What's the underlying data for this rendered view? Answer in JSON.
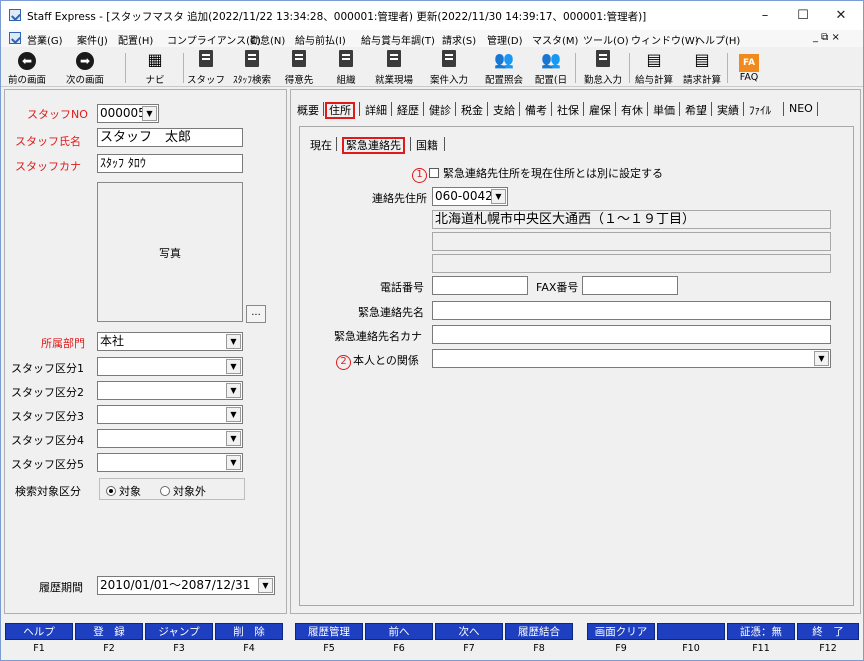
{
  "title_bar": {
    "text": "Staff Express - [スタッフマスタ 追加(2022/11/22 13:34:28、000001:管理者) 更新(2022/11/30 14:39:17、000001:管理者)]",
    "min": "–",
    "max": "☐",
    "close": "✕"
  },
  "menu": [
    "営業(G)",
    "案件(J)",
    "配置(H)",
    "コンプライアンス(C)",
    "勤怠(N)",
    "給与前払(I)",
    "給与賞与年調(T)",
    "請求(S)",
    "管理(D)",
    "マスタ(M)",
    "ツール(O)",
    "ウィンドウ(W)",
    "ヘルプ(H)"
  ],
  "menu_right": "_ ⧉ ×",
  "toolbar": [
    "前の画面",
    "次の画面",
    "ナビ",
    "スタッフ",
    "ｽﾀｯﾌ検索",
    "得意先",
    "組織",
    "就業現場",
    "案件入力",
    "配置照会",
    "配置(日",
    "勤怠入力",
    "給与計算",
    "請求計算",
    "FAQ"
  ],
  "left": {
    "staff_no_label": "スタッフNO",
    "staff_no": "000005",
    "staff_name_label": "スタッフ氏名",
    "staff_name": "スタッフ　太郎",
    "staff_kana_label": "スタッフカナ",
    "staff_kana": "ｽﾀｯﾌ ﾀﾛｳ",
    "photo_label": "写真",
    "photo_btn": "...",
    "dept_label": "所属部門",
    "dept": "本社",
    "kubun_labels": [
      "スタッフ区分1",
      "スタッフ区分2",
      "スタッフ区分3",
      "スタッフ区分4",
      "スタッフ区分5"
    ],
    "search_label": "検索対象区分",
    "radio_on": "対象",
    "radio_off": "対象外",
    "period_label": "履歴期間",
    "period": "2010/01/01～2087/12/31"
  },
  "tabs": [
    "概要",
    "住所",
    "詳細",
    "経歴",
    "健診",
    "税金",
    "支給",
    "備考",
    "社保",
    "雇保",
    "有休",
    "単価",
    "希望",
    "実績",
    "ﾌｧｲﾙ",
    "NEO"
  ],
  "subtabs": [
    "現在",
    "緊急連絡先",
    "国籍"
  ],
  "form": {
    "marker1": "1",
    "checkbox_label": "緊急連絡先住所を現在住所とは別に設定する",
    "zip_label": "連絡先住所",
    "zip": "060-0042",
    "addr1": "北海道札幌市中央区大通西（１〜１９丁目）",
    "tel_label": "電話番号",
    "fax_label": "FAX番号",
    "name_label": "緊急連絡先名",
    "kana_label": "緊急連絡先名カナ",
    "marker2": "2",
    "relation_label": "本人との関係"
  },
  "fkeys": [
    {
      "label": "ヘルプ",
      "key": "F1"
    },
    {
      "label": "登　録",
      "key": "F2"
    },
    {
      "label": "ジャンプ",
      "key": "F3"
    },
    {
      "label": "削　除",
      "key": "F4"
    },
    {
      "label": "履歴管理",
      "key": "F5"
    },
    {
      "label": "前へ",
      "key": "F6"
    },
    {
      "label": "次へ",
      "key": "F7"
    },
    {
      "label": "履歴結合",
      "key": "F8"
    },
    {
      "label": "画面クリア",
      "key": "F9"
    },
    {
      "label": "",
      "key": "F10"
    },
    {
      "label": "証憑：無",
      "key": "F11"
    },
    {
      "label": "終　了",
      "key": "F12"
    }
  ],
  "colors": {
    "accent_red": "#e01a1a",
    "fkey_blue": "#1e3fbf"
  }
}
